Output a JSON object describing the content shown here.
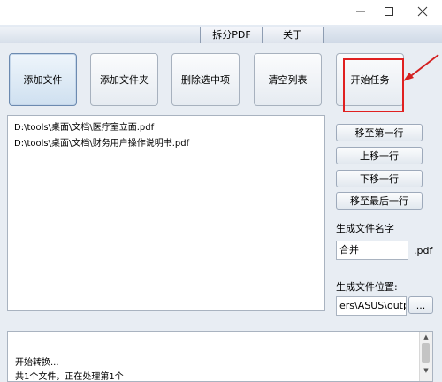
{
  "window": {
    "minimize_icon": "minimize-icon",
    "maximize_icon": "maximize-icon",
    "close_icon": "close-icon"
  },
  "tabs": [
    {
      "label": "拆分PDF"
    },
    {
      "label": "关于"
    }
  ],
  "toolbar": {
    "add_file": "添加文件",
    "add_folder": "添加文件夹",
    "delete_selected": "删除选中项",
    "clear_list": "清空列表",
    "start_task": "开始任务"
  },
  "file_list": [
    {
      "path": "D:\\tools\\桌面\\文档\\医疗室立面.pdf"
    },
    {
      "path": "D:\\tools\\桌面\\文档\\财务用户操作说明书.pdf"
    }
  ],
  "side_buttons": {
    "move_first": "移至第一行",
    "move_up": "上移一行",
    "move_down": "下移一行",
    "move_last": "移至最后一行"
  },
  "output": {
    "name_label": "生成文件名字",
    "name_value": "合并",
    "ext": ".pdf",
    "location_label": "生成文件位置:",
    "location_value": "ers\\ASUS\\output",
    "browse_label": "..."
  },
  "log": {
    "lines": [
      "开始转换...",
      "共1个文件，正在处理第1个"
    ]
  },
  "colors": {
    "highlight": "#e02020",
    "arrow": "#d42020"
  }
}
